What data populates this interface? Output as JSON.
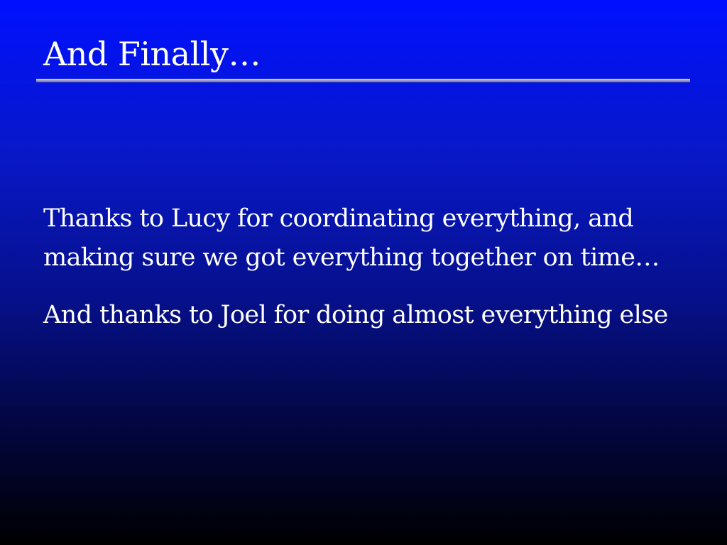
{
  "slide": {
    "title": "And Finally…",
    "paragraphs": [
      "Thanks to Lucy for coordinating everything, and making sure we got everything together on time…",
      "And thanks to Joel for doing almost everything else"
    ]
  },
  "colors": {
    "background_top": "#0010ff",
    "background_bottom": "#000000",
    "text": "#ffffff",
    "rule": "#9a9ab4"
  }
}
